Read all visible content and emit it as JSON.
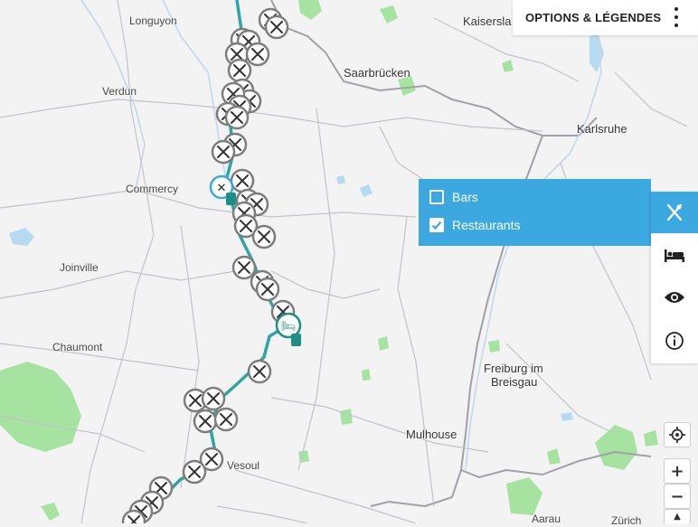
{
  "header": {
    "options_label": "OPTIONS & LÉGENDES"
  },
  "filter": {
    "items": [
      {
        "label": "Bars",
        "checked": false
      },
      {
        "label": "Restaurants",
        "checked": true
      }
    ]
  },
  "side_tabs": [
    {
      "icon": "fork-knife-icon",
      "active": true
    },
    {
      "icon": "bed-icon",
      "active": false
    },
    {
      "icon": "eye-icon",
      "active": false
    },
    {
      "icon": "info-icon",
      "active": false
    }
  ],
  "map_controls": {
    "locate_icon": "crosshair-icon",
    "zoom_in": "+",
    "zoom_out": "−",
    "scroll_up": "▲"
  },
  "cities": {
    "longuyon": "Longuyon",
    "kaiserslautern": "Kaisersla",
    "saarbrucken": "Saarbrücken",
    "verdun": "Verdun",
    "karlsruhe": "Karlsruhe",
    "commercy": "Commercy",
    "joinville": "Joinville",
    "chaumont": "Chaumont",
    "freiburg_1": "Freiburg im",
    "freiburg_2": "Breisgau",
    "vesoul": "Vesoul",
    "mulhouse": "Mulhouse",
    "aarau": "Aarau",
    "zurich": "Zürich"
  },
  "colors": {
    "accent": "#3ba8e0",
    "route": "#2fa6a3",
    "poi": "#7d7d7d",
    "lodging": "#1e8f87",
    "forest": "#a6e3a0",
    "water": "#b5dbf0",
    "border": "#a0a0a8"
  }
}
